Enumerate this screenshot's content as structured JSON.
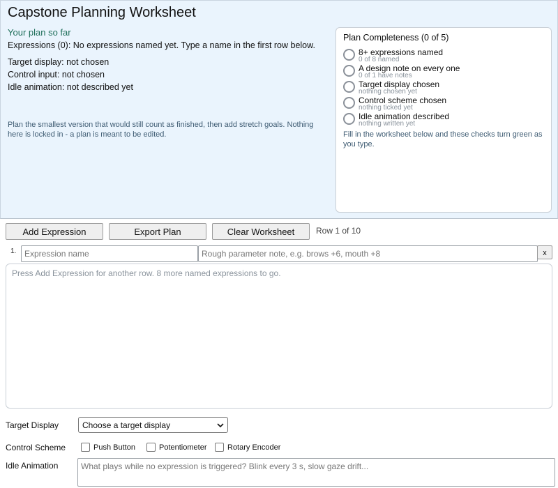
{
  "app": {
    "title": "Capstone Planning Worksheet"
  },
  "summary": {
    "heading": "Your plan so far",
    "expressions": "Expressions (0): No expressions named yet. Type a name in the first row below.",
    "target_display": "Target display: not chosen",
    "control_input": "Control input: not chosen",
    "idle_animation": "Idle animation: not described yet",
    "hint": "Plan the smallest version that would still count as finished, then add stretch goals. Nothing here is locked in - a plan is meant to be edited."
  },
  "completeness": {
    "title": "Plan Completeness  (0 of 5)",
    "items": [
      {
        "label": "8+ expressions named",
        "sub": "0 of 8 named"
      },
      {
        "label": "A design note on every one",
        "sub": "0 of 1 have notes"
      },
      {
        "label": "Target display chosen",
        "sub": "nothing chosen yet"
      },
      {
        "label": "Control scheme chosen",
        "sub": "nothing ticked yet"
      },
      {
        "label": "Idle animation described",
        "sub": "nothing written yet"
      }
    ],
    "footer": "Fill in the worksheet below and these checks turn green as you type."
  },
  "toolbar": {
    "add_label": "Add Expression",
    "export_label": "Export Plan",
    "clear_label": "Clear Worksheet",
    "row_count": "Row 1 of 10"
  },
  "rows": [
    {
      "number": "1.",
      "name_placeholder": "Expression name",
      "note_placeholder": "Rough parameter note, e.g. brows +6, mouth +8",
      "remove_label": "x"
    }
  ],
  "rows_hint": "Press Add Expression for another row. 8 more named expressions to go.",
  "form": {
    "target_display_label": "Target Display",
    "target_display_value": "Choose a target display",
    "control_scheme_label": "Control Scheme",
    "control_options": [
      "Push Button",
      "Potentiometer",
      "Rotary Encoder"
    ],
    "idle_animation_label": "Idle Animation",
    "idle_animation_placeholder": "What plays while no expression is triggered? Blink every 3 s, slow gaze drift..."
  }
}
